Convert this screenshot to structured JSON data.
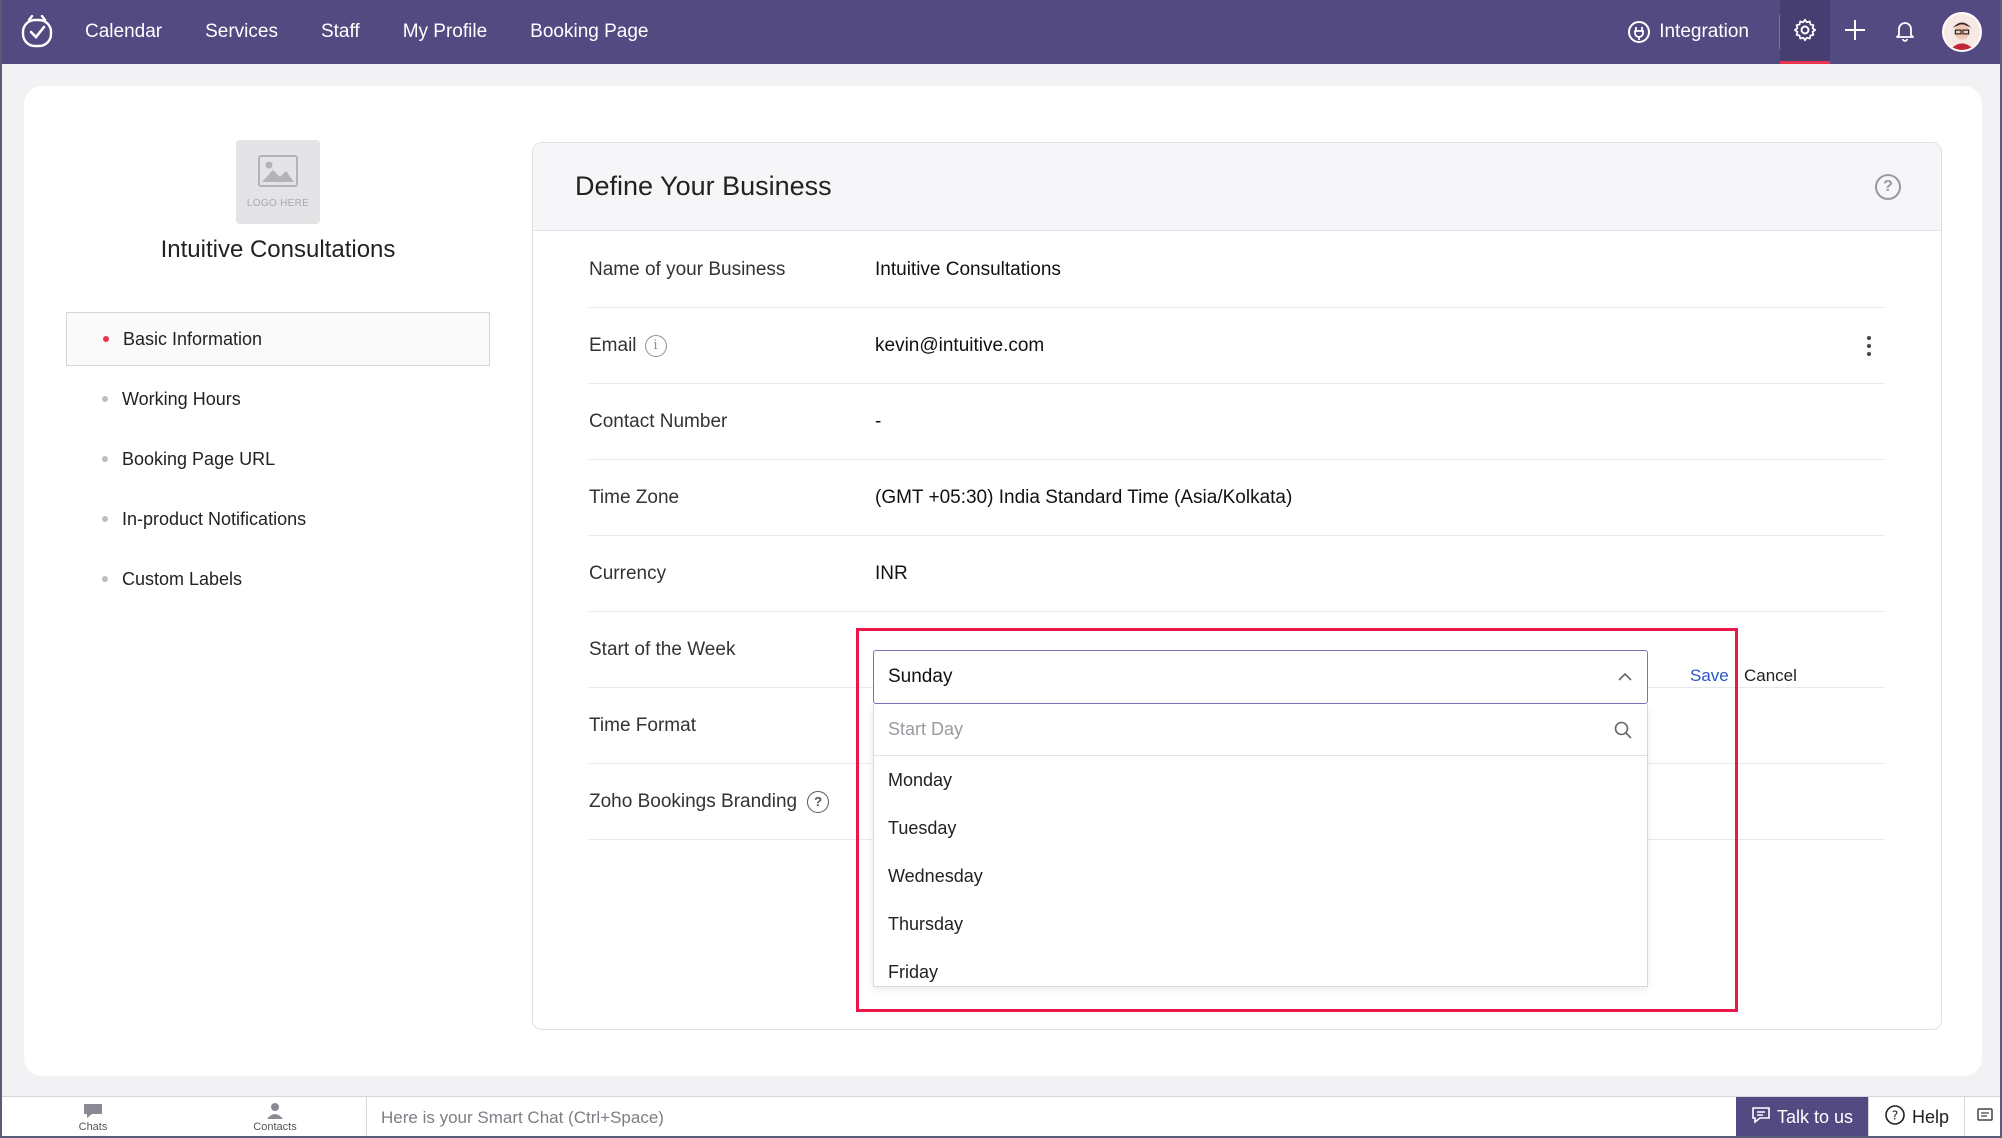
{
  "nav": {
    "items": [
      "Calendar",
      "Services",
      "Staff",
      "My Profile",
      "Booking Page"
    ],
    "integration": "Integration"
  },
  "sidebar": {
    "logo_text": "LOGO HERE",
    "business_name": "Intuitive Consultations",
    "items": [
      {
        "label": "Basic Information",
        "active": true
      },
      {
        "label": "Working Hours",
        "active": false
      },
      {
        "label": "Booking Page URL",
        "active": false
      },
      {
        "label": "In-product Notifications",
        "active": false
      },
      {
        "label": "Custom Labels",
        "active": false
      }
    ]
  },
  "panel": {
    "title": "Define Your Business",
    "rows": [
      {
        "label": "Name of your Business",
        "value": "Intuitive Consultations"
      },
      {
        "label": "Email",
        "value": "kevin@intuitive.com"
      },
      {
        "label": "Contact Number",
        "value": "-"
      },
      {
        "label": "Time Zone",
        "value": "(GMT +05:30) India Standard Time (Asia/Kolkata)"
      },
      {
        "label": "Currency",
        "value": "INR"
      },
      {
        "label": "Start of the Week",
        "value": ""
      },
      {
        "label": "Time Format",
        "value": ""
      },
      {
        "label": "Zoho Bookings Branding",
        "value": ""
      }
    ]
  },
  "dropdown": {
    "selected": "Sunday",
    "search_placeholder": "Start Day",
    "options": [
      "Monday",
      "Tuesday",
      "Wednesday",
      "Thursday",
      "Friday"
    ],
    "save_label": "Save",
    "cancel_label": "Cancel"
  },
  "bottombar": {
    "chats": "Chats",
    "contacts": "Contacts",
    "smart_chat": "Here is your Smart Chat (Ctrl+Space)",
    "talk": "Talk to us",
    "help": "Help"
  },
  "colors": {
    "nav_bg": "#524a80",
    "accent_red": "#e8344e",
    "highlight": "#e8194a",
    "link_blue": "#2a56c6"
  }
}
